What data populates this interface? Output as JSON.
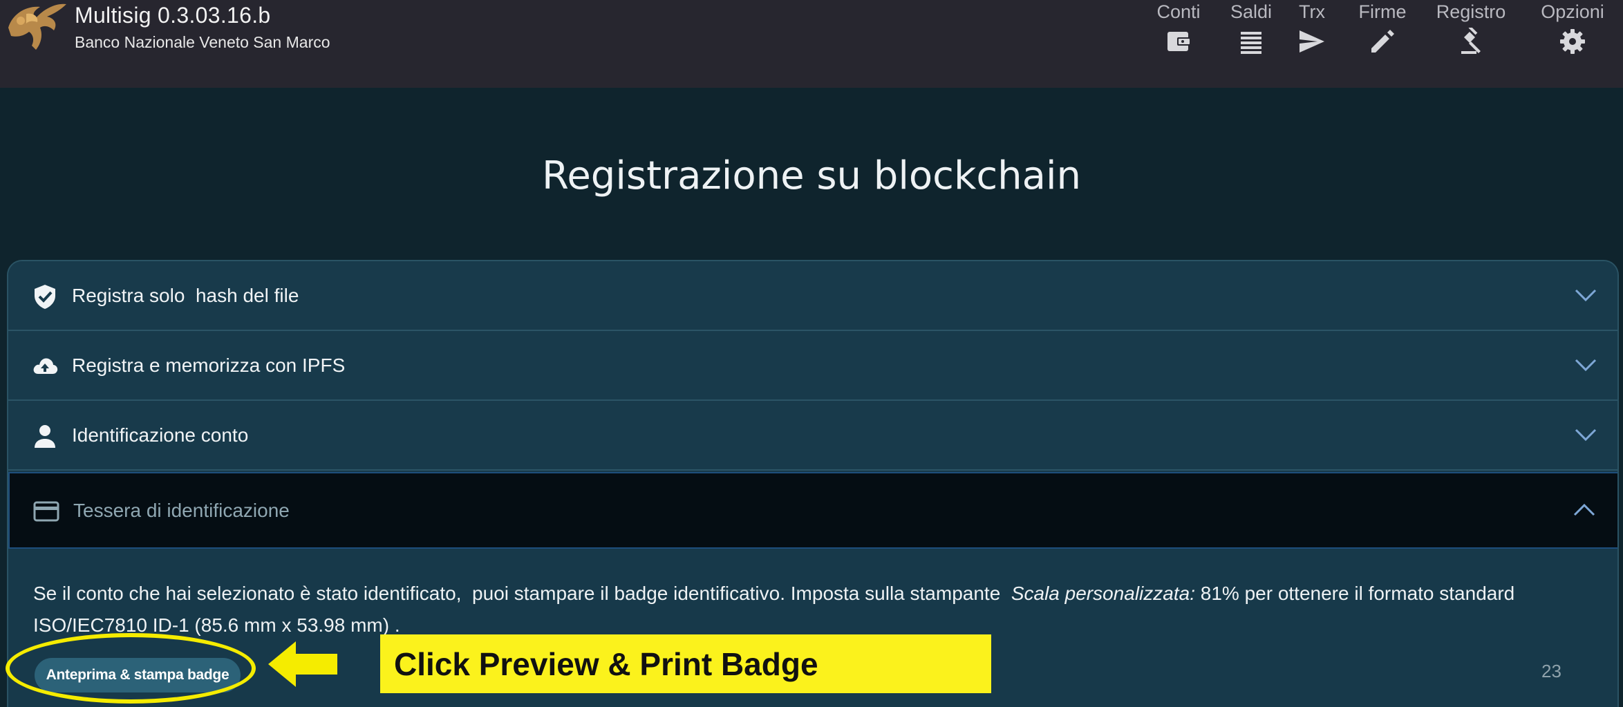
{
  "header": {
    "app_title": "Multisig 0.3.03.16.b",
    "subtitle": "Banco Nazionale Veneto San Marco",
    "nav": [
      {
        "label": "Conti",
        "icon": "wallet-icon"
      },
      {
        "label": "Saldi",
        "icon": "list-icon"
      },
      {
        "label": "Trx",
        "icon": "send-icon"
      },
      {
        "label": "Firme",
        "icon": "pencil-icon"
      },
      {
        "label": "Registro",
        "icon": "gavel-icon"
      },
      {
        "label": "Opzioni",
        "icon": "gear-icon"
      }
    ]
  },
  "page": {
    "title": "Registrazione su blockchain"
  },
  "accordion": {
    "items": [
      {
        "label": "Registra solo  hash del file",
        "icon": "shield-check-icon",
        "expanded": false
      },
      {
        "label": "Registra e memorizza con IPFS",
        "icon": "cloud-upload-icon",
        "expanded": false
      },
      {
        "label": "Identificazione conto",
        "icon": "person-icon",
        "expanded": false
      },
      {
        "label": "Tessera di identificazione",
        "icon": "credit-card-icon",
        "expanded": true
      }
    ],
    "open_panel": {
      "text_before": "Se il conto che hai selezionato è stato identificato,  puoi stampare il badge identificativo. Imposta sulla stampante  ",
      "text_italic": "Scala personalizzata:",
      "text_after": " 81% per ottenere il formato standard ISO/IEC7810 ID-1 (85.6 mm x 53.98 mm) .",
      "button_label": "Anteprima & stampa badge"
    }
  },
  "page_number": "23",
  "annotation": {
    "text": "Click Preview & Print Badge"
  },
  "colors": {
    "header_bg": "#27262f",
    "page_bg": "#0f242d",
    "accordion_bg": "#183a4b",
    "open_header_bg": "#050d13",
    "button_bg": "#2c6278",
    "callout": "#fbf21c"
  }
}
